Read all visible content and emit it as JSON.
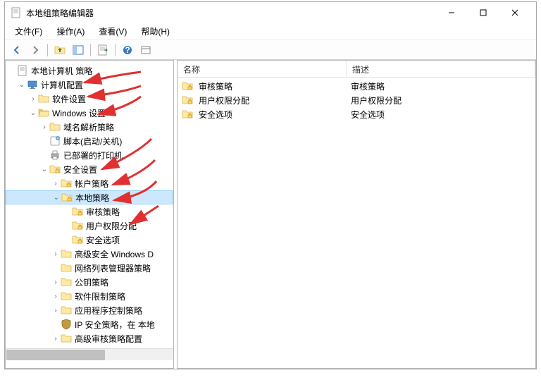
{
  "window": {
    "title": "本地组策略编辑器"
  },
  "menu": {
    "file": "文件(F)",
    "action": "操作(A)",
    "view": "查看(V)",
    "help": "帮助(H)"
  },
  "tree": {
    "root": "本地计算机 策略",
    "computer_config": "计算机配置",
    "software_settings": "软件设置",
    "windows_settings": "Windows 设置",
    "dns_policy": "域名解析策略",
    "scripts": "脚本(启动/关机)",
    "printers": "已部署的打印机",
    "security_settings": "安全设置",
    "account_policy": "帐户策略",
    "local_policy": "本地策略",
    "audit_policy": "审核策略",
    "user_rights": "用户权限分配",
    "security_options": "安全选项",
    "advanced_windows": "高级安全 Windows D",
    "network_admin": "网络列表管理器策略",
    "public_key": "公钥策略",
    "restricted_software": "软件限制策略",
    "app_control": "应用程序控制策略",
    "ip_security": "IP 安全策略，在 本地",
    "advanced_audit": "高级审核策略配置"
  },
  "list": {
    "header_name": "名称",
    "header_desc": "描述",
    "rows": [
      {
        "name": "审核策略",
        "desc": "审核策略"
      },
      {
        "name": "用户权限分配",
        "desc": "用户权限分配"
      },
      {
        "name": "安全选项",
        "desc": "安全选项"
      }
    ]
  }
}
